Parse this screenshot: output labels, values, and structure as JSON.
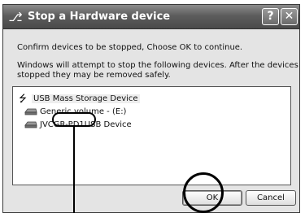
{
  "window": {
    "title": "Stop a Hardware device",
    "help_label": "?",
    "close_label": "✕",
    "app_icon": "hardware-icon"
  },
  "message": {
    "line1": "Confirm devices to be stopped, Choose OK to continue.",
    "line2a": "Windows will attempt to stop the following devices. After the devices are",
    "line2b": "stopped they may be removed safely."
  },
  "devices": [
    {
      "label": "USB Mass Storage Device",
      "icon": "usb-icon",
      "selected": true
    },
    {
      "label": "Generic volume - (E:)",
      "icon": "drive-icon",
      "selected": false
    },
    {
      "prefix": "JVC ",
      "model": "GR-PD1",
      "suffix": " USB Device",
      "icon": "drive-icon",
      "selected": false
    }
  ],
  "buttons": {
    "ok": "OK",
    "cancel": "Cancel"
  }
}
